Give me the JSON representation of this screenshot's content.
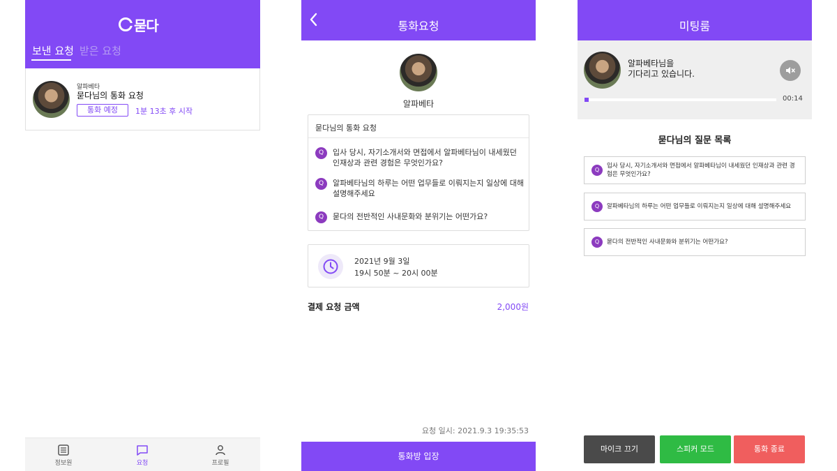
{
  "colors": {
    "brand": "#8249f5",
    "q_icon": "#8c3bbf",
    "speaker": "#2fbb44",
    "end_call": "#f05e5e",
    "mic_off": "#4a4a4a"
  },
  "screen1": {
    "logo_text": "묻다",
    "tabs": {
      "sent": "보낸 요청",
      "received": "받은 요청"
    },
    "request": {
      "small_name": "알파베타",
      "title": "묻다님의 통화 요청",
      "badge": "통화 예정",
      "time": "1분 13초 후 시작"
    },
    "nav": {
      "info": "정보원",
      "request": "요청",
      "profile": "프로필"
    }
  },
  "screen2": {
    "title": "통화요청",
    "name": "알파베타",
    "questions_header": "묻다님의 통화 요청",
    "q_label": "Q",
    "questions": [
      "입사 당시, 자기소개서와 면접에서 알파베타님이 내세웠던 인재상과 관련 경험은 무엇인가요?",
      "알파베타님의 하루는 어떤 업무들로 이뤄지는지 일상에 대해 설명해주세요",
      "묻다의 전반적인 사내문화와 분위기는 어떤가요?"
    ],
    "date": "2021년 9월 3일",
    "time_range": "19시 50분 ~ 20시 00분",
    "payment_label": "결제 요청 금액",
    "payment_amount": "2,000원",
    "request_datetime": "요청 일시: 2021.9.3 19:35:53",
    "enter_button": "통화방 입장"
  },
  "screen3": {
    "title": "미팅룸",
    "waiting_line1": "알파베타님을",
    "waiting_line2": "기다리고 있습니다.",
    "progress_fraction": 0.02,
    "elapsed": "00:14",
    "list_title": "묻다님의 질문 목록",
    "q_label": "Q",
    "questions": [
      "입사 당시, 자기소개서와 면접에서 알파베타님이 내세웠던 인재상과 관련 경험은 무엇인가요?",
      "알파베타님의 하루는 어떤 업무들로 이뤄지는지 일상에 대해 설명해주세요",
      "묻다의 전반적인 사내문화와 분위기는 어떤가요?"
    ],
    "buttons": {
      "mic": "마이크 끄기",
      "speaker": "스피커 모드",
      "end": "통화 종료"
    }
  }
}
